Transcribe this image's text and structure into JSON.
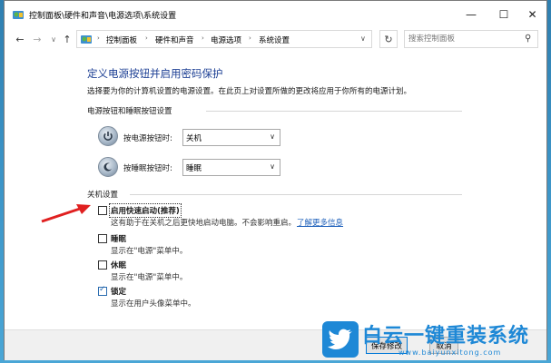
{
  "window": {
    "title": "控制面板\\硬件和声音\\电源选项\\系统设置",
    "controls": {
      "minimize": "—",
      "maximize": "☐",
      "close": "✕"
    }
  },
  "nav": {
    "back": "←",
    "forward": "→",
    "recent": "∨",
    "up": "↑",
    "breadcrumbs": [
      "控制面板",
      "硬件和声音",
      "电源选项",
      "系统设置"
    ],
    "separator": "›",
    "address_dropdown": "∨",
    "refresh": "↻",
    "search_placeholder": "搜索控制面板"
  },
  "page": {
    "title": "定义电源按钮并启用密码保护",
    "description": "选择要为你的计算机设置的电源设置。在此页上对设置所做的更改将应用于你所有的电源计划。",
    "power_section": {
      "header": "电源按钮和睡眠按钮设置",
      "rows": [
        {
          "label": "按电源按钮时:",
          "value": "关机"
        },
        {
          "label": "按睡眠按钮时:",
          "value": "睡眠"
        }
      ]
    },
    "shutdown_section": {
      "header": "关机设置",
      "options": [
        {
          "label": "启用快速启动(推荐)",
          "checked": false,
          "description": "这有助于在关机之后更快地启动电脑。不会影响重启。",
          "link": "了解更多信息"
        },
        {
          "label": "睡眠",
          "checked": false,
          "description": "显示在\"电源\"菜单中。"
        },
        {
          "label": "休眠",
          "checked": false,
          "description": "显示在\"电源\"菜单中。"
        },
        {
          "label": "锁定",
          "checked": true,
          "description": "显示在用户头像菜单中。"
        }
      ]
    }
  },
  "footer": {
    "save": "保存修改",
    "cancel": "取消"
  },
  "watermark": {
    "title": "白云一键重装系统",
    "url": "www.baiyunxitong.com"
  },
  "colors": {
    "title_blue": "#1c3f94",
    "link_blue": "#1c5fba",
    "annotation_red": "#e02020",
    "watermark_blue": "#1e88d6"
  }
}
